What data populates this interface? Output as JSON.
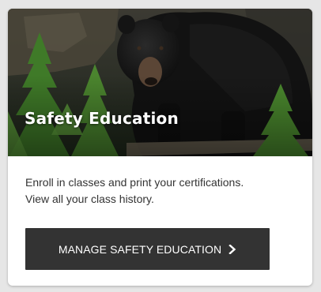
{
  "card": {
    "title": "Safety Education",
    "description_line1": "Enroll in classes and print your certifications.",
    "description_line2": "View all your class history.",
    "button_label": "MANAGE SAFETY EDUCATION",
    "hero_image_icon": "black-bear-photo"
  },
  "colors": {
    "button_bg": "#333333",
    "button_text": "#ffffff",
    "card_bg": "#ffffff",
    "text": "#333333"
  }
}
